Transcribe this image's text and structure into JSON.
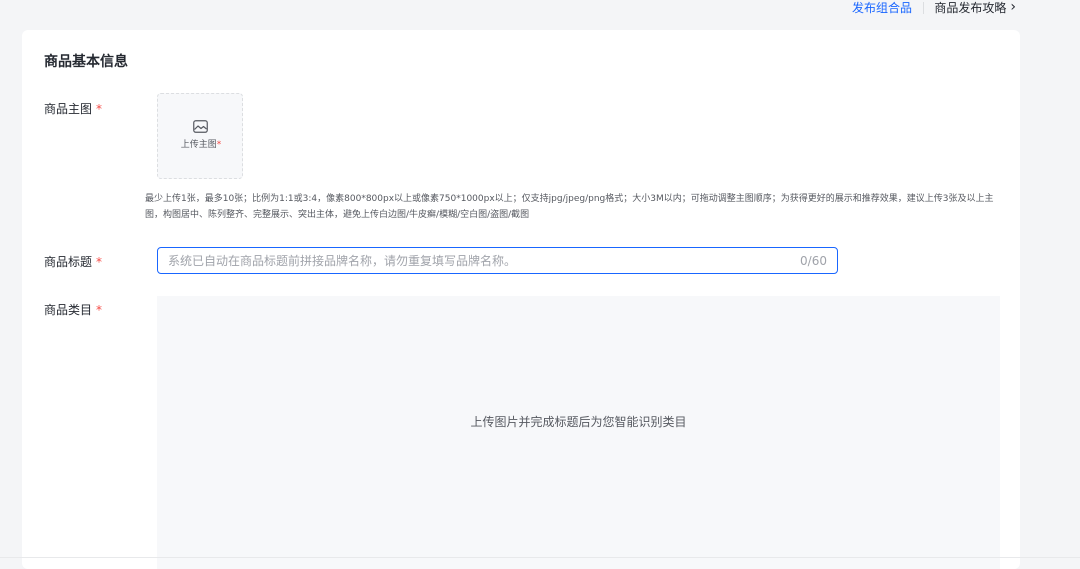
{
  "header": {
    "combo_link": "发布组合品",
    "guide_link": "商品发布攻略"
  },
  "section": {
    "title": "商品基本信息"
  },
  "main_image": {
    "label": "商品主图",
    "required_mark": "*",
    "upload_text": "上传主图",
    "upload_required_mark": "*",
    "hint": "最少上传1张，最多10张；比例为1:1或3:4，像素800*800px以上或像素750*1000px以上；仅支持jpg/jpeg/png格式；大小3M以内；可拖动调整主图顺序；为获得更好的展示和推荐效果，建议上传3张及以上主图，构图居中、陈列整齐、完整展示、突出主体，避免上传白边图/牛皮癣/模糊/空白图/盗图/截图"
  },
  "title_field": {
    "label": "商品标题",
    "required_mark": "*",
    "placeholder": "系统已自动在商品标题前拼接品牌名称，请勿重复填写品牌名称。",
    "counter": "0/60"
  },
  "category_field": {
    "label": "商品类目",
    "required_mark": "*",
    "placeholder_text": "上传图片并完成标题后为您智能识别类目"
  },
  "colors": {
    "accent": "#1966ff",
    "required": "#f54a45",
    "page_bg": "#f4f5f7",
    "card_bg": "#ffffff",
    "muted_bg": "#f7f8fa"
  }
}
